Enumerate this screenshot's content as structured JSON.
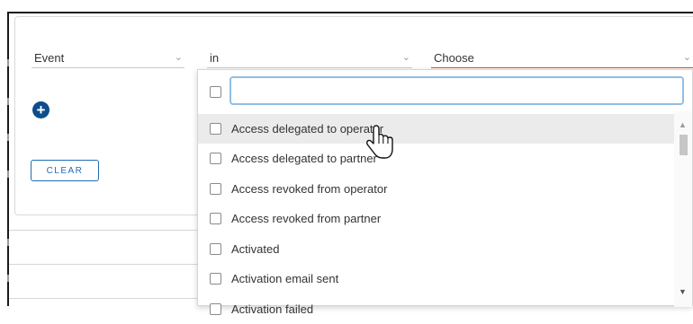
{
  "filter": {
    "field": {
      "label": "Event",
      "icon": "chevron-down-icon"
    },
    "operator": {
      "label": "in",
      "icon": "chevron-down-icon"
    },
    "value": {
      "label": "Choose",
      "icon": "chevron-down-icon",
      "accent_color": "#d74c2f"
    }
  },
  "add_button": {
    "icon": "plus-circle-icon",
    "symbol": "+",
    "color": "#0d4d8c"
  },
  "clear_button": {
    "label": "CLEAR",
    "color": "#1f6cb5"
  },
  "dropdown": {
    "search": {
      "value": "",
      "placeholder": ""
    },
    "options": [
      {
        "label": "Access delegated to operator",
        "checked": false,
        "hovered": true
      },
      {
        "label": "Access delegated to partner",
        "checked": false
      },
      {
        "label": "Access revoked from operator",
        "checked": false
      },
      {
        "label": "Access revoked from partner",
        "checked": false
      },
      {
        "label": "Activated",
        "checked": false
      },
      {
        "label": "Activation email sent",
        "checked": false
      },
      {
        "label": "Activation failed",
        "checked": false
      }
    ],
    "scrollbar": {
      "up_icon": "triangle-up-icon",
      "down_icon": "triangle-down-icon"
    }
  },
  "colors": {
    "hover_bg": "#ebebeb",
    "focus_ring": "#8fbee6"
  }
}
